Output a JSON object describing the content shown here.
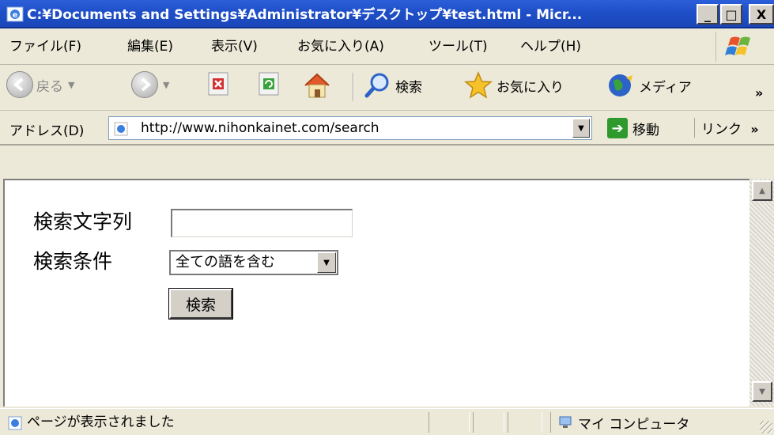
{
  "window": {
    "title": "C:¥Documents and Settings¥Administrator¥デスクトップ¥test.html - Micr...",
    "buttons": {
      "minimize": "_",
      "maximize": "□",
      "close": "X"
    }
  },
  "menu": {
    "items": [
      "ファイル(F)",
      "編集(E)",
      "表示(V)",
      "お気に入り(A)",
      "ツール(T)",
      "ヘルプ(H)"
    ]
  },
  "toolbar": {
    "back_label": "戻る",
    "search_label": "検索",
    "favorites_label": "お気に入り",
    "media_label": "メディア",
    "more": "»"
  },
  "address": {
    "label": "アドレス(D)",
    "url": "http://www.nihonkainet.com/search",
    "go_label": "移動",
    "links_label": "リンク",
    "more": "»"
  },
  "page": {
    "search_text_label": "検索文字列",
    "search_text_value": "",
    "condition_label": "検索条件",
    "condition_selected": "全ての語を含む",
    "submit_label": "検索"
  },
  "status": {
    "text": "ページが表示されました",
    "zone_label": "マイ コンピュータ"
  },
  "colors": {
    "titlebar": "#1f4fc8",
    "chrome": "#ece9d8",
    "content_bg": "#ffffff"
  },
  "icons": [
    "ie-page-icon",
    "windows-logo-icon",
    "back-icon",
    "forward-icon",
    "stop-icon",
    "refresh-icon",
    "home-icon",
    "search-icon",
    "favorites-star-icon",
    "media-globe-icon",
    "go-arrow-icon",
    "computer-icon"
  ]
}
